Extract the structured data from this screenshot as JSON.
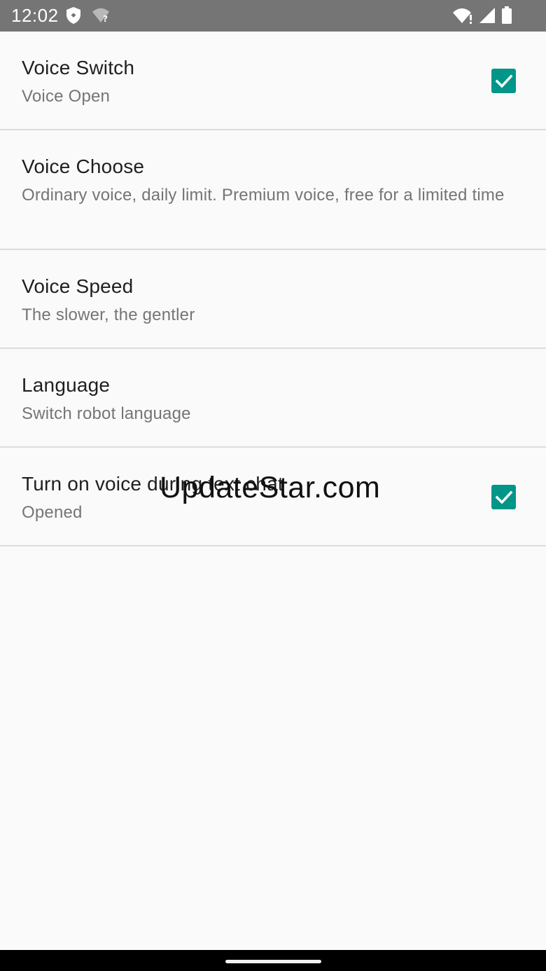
{
  "status_bar": {
    "time": "12:02",
    "left_icons": [
      "shield-icon",
      "wifi-unknown-icon"
    ],
    "right_icons": [
      "wifi-alert-icon",
      "signal-icon",
      "battery-icon"
    ],
    "background": "#757575"
  },
  "settings": [
    {
      "title": "Voice Switch",
      "summary": "Voice Open",
      "checked": true
    },
    {
      "title": "Voice Choose",
      "summary": "Ordinary voice, daily limit. Premium voice, free for a limited time"
    },
    {
      "title": "Voice Speed",
      "summary": "The slower, the gentler"
    },
    {
      "title": "Language",
      "summary": "Switch robot language"
    },
    {
      "title": "Turn on voice during text chat",
      "summary": "Opened",
      "checked": true
    }
  ],
  "watermark": "UpdateStar.com",
  "colors": {
    "accent": "#009688",
    "background": "#fafafa",
    "divider": "#dcdcdc",
    "title_text": "#1f1f1f",
    "summary_text": "#757575"
  }
}
